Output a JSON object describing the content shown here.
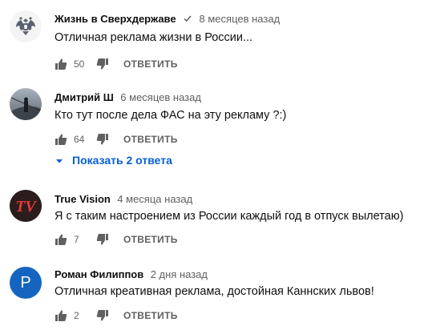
{
  "comments": [
    {
      "author": "Жизнь в Сверхдержаве",
      "verified": true,
      "time": "8 месяцев назад",
      "text": "Отличная реклама жизни в России...",
      "likes": "50",
      "reply_label": "ОТВЕТИТЬ",
      "avatar_icon": "double-headed-eagle-emblem"
    },
    {
      "author": "Дмитрий Ш",
      "time": "6 месяцев назад",
      "text": "Кто тут после дела ФАС на эту рекламу ?:)",
      "likes": "64",
      "reply_label": "ОТВЕТИТЬ",
      "avatar_icon": "photo-person-bridge",
      "show_replies": "Показать 2 ответа"
    },
    {
      "author": "True Vision",
      "time": "4 месяца назад",
      "text": "Я с таким настроением из России каждый год в отпуск вылетаю)",
      "likes": "7",
      "reply_label": "ОТВЕТИТЬ",
      "avatar_icon": "tv-logo",
      "avatar_text": "TV"
    },
    {
      "author": "Роман Филиппов",
      "time": "2 дня назад",
      "text": "Отличная креативная реклама, достойная Каннских львов!",
      "likes": "2",
      "reply_label": "ОТВЕТИТЬ",
      "avatar_icon": "letter-avatar",
      "avatar_letter": "Р"
    }
  ],
  "colors": {
    "link_blue": "#065fd4",
    "meta_gray": "#606060",
    "letter_avatar_bg": "#1565c0"
  }
}
